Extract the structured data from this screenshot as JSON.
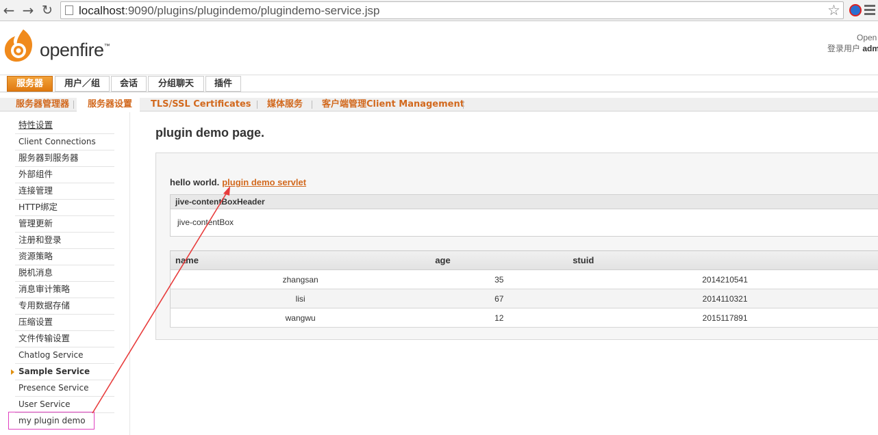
{
  "browser": {
    "url_host": "localhost",
    "url_rest": ":9090/plugins/plugindemo/plugindemo-service.jsp",
    "icons": [
      "back-icon",
      "forward-icon",
      "reload-icon",
      "star-icon",
      "menu-icon"
    ]
  },
  "header": {
    "logo_text": "openfire",
    "logo_tm": "™",
    "user_line1": "Open",
    "user_label": "登录用户",
    "user_name": "adm"
  },
  "main_tabs": [
    "服务器",
    "用户／组",
    "会话",
    "分组聊天",
    "插件"
  ],
  "sub_tabs": [
    "服务器管理器",
    "服务器设置",
    "TLS/SSL Certificates",
    "媒体服务",
    "客户端管理Client Management"
  ],
  "sidebar": {
    "items": [
      "特性设置",
      "Client Connections",
      "服务器到服务器",
      "外部组件",
      "连接管理",
      "HTTP绑定",
      "管理更新",
      "注册和登录",
      "资源策略",
      "脱机消息",
      "消息审计策略",
      "专用数据存储",
      "压缩设置",
      "文件传输设置",
      "Chatlog Service",
      "Sample Service",
      "Presence Service",
      "User Service",
      "my plugin demo"
    ]
  },
  "main": {
    "title": "plugin demo page.",
    "hello": "hello world.",
    "link": "plugin demo servlet",
    "box_header": "jive-contentBoxHeader",
    "box_body": "jive-contentBox",
    "table": {
      "headers": [
        "name",
        "age",
        "stuid"
      ],
      "rows": [
        [
          "zhangsan",
          "35",
          "2014210541"
        ],
        [
          "lisi",
          "67",
          "2014110321"
        ],
        [
          "wangwu",
          "12",
          "2015117891"
        ]
      ]
    }
  },
  "colors": {
    "accent": "#e07a10",
    "link": "#d2691e",
    "annotation": "#e83c3c",
    "highlight_box": "#e040c0"
  }
}
